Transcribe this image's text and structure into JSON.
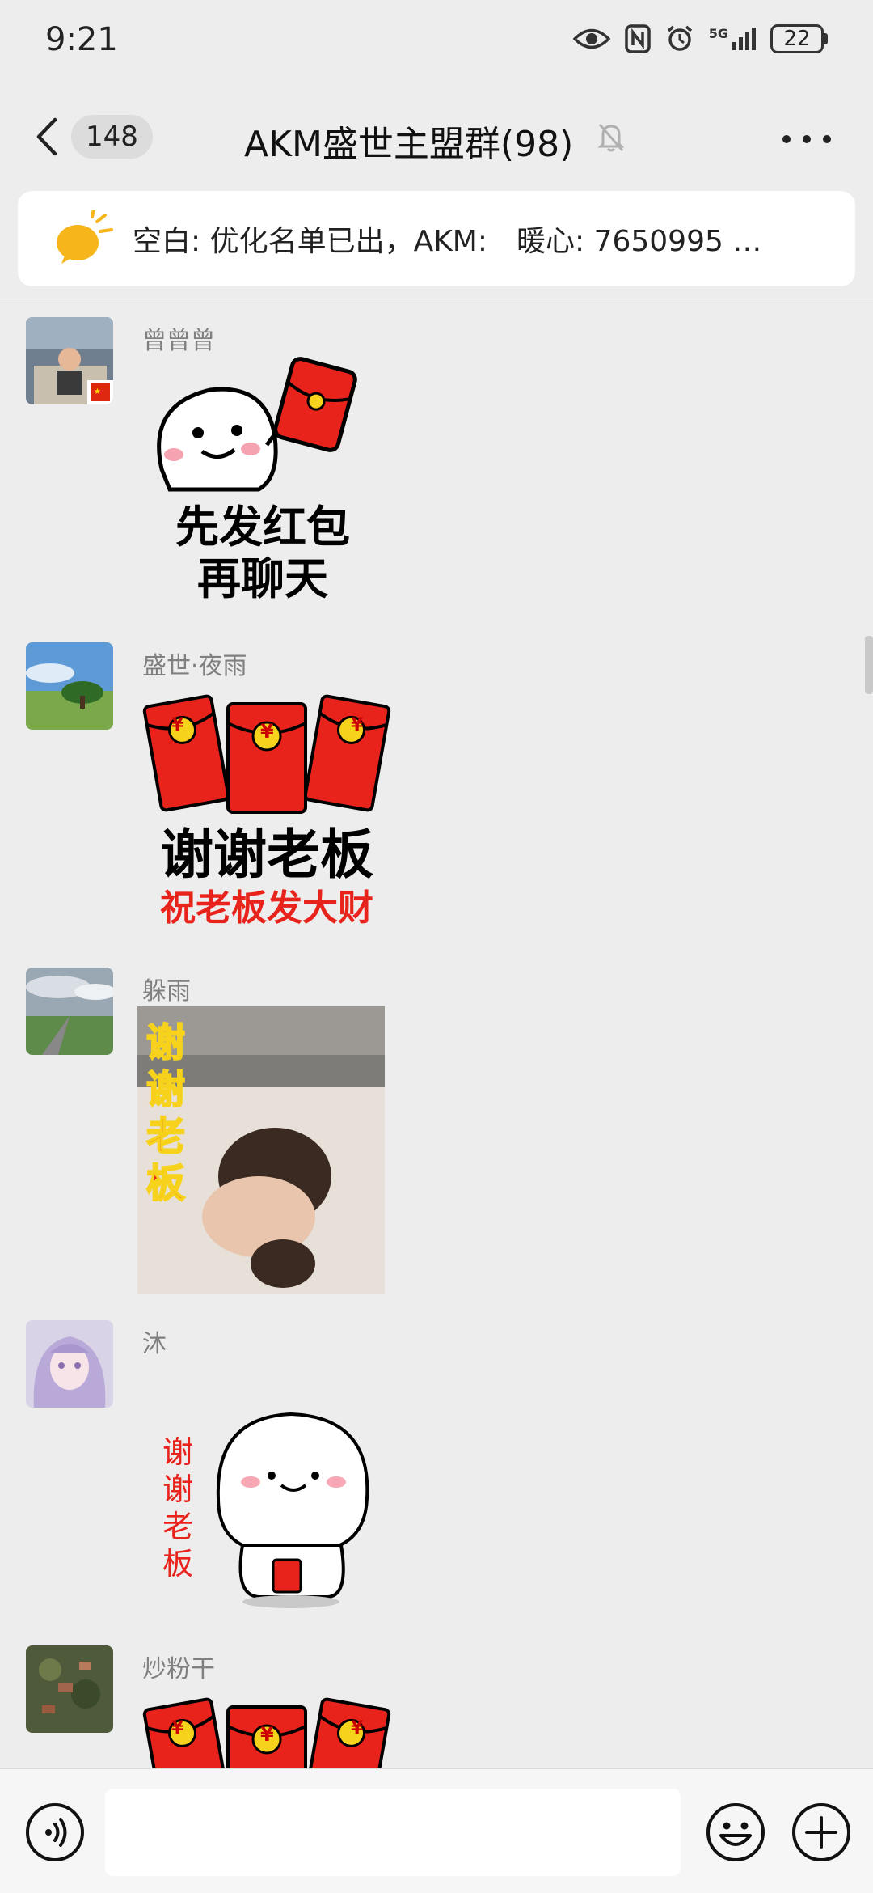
{
  "status_bar": {
    "time": "9:21",
    "network": "5G",
    "battery": "22"
  },
  "title_bar": {
    "unread_count": "148",
    "title": "AKM盛世主盟群(98)"
  },
  "notice": {
    "text": "空白: 优化名单已出，AKM:　暖心: 7650995 …"
  },
  "messages": [
    {
      "sender": "曾曾曾",
      "avatar_icon": "child-photo-avatar",
      "sticker_icon": "smiley-holding-red-envelope-sticker",
      "sticker_lines": [
        "先发红包",
        "再聊天"
      ]
    },
    {
      "sender": "盛世·夜雨",
      "avatar_icon": "landscape-tree-avatar",
      "sticker_icon": "red-envelopes-sticker",
      "envelope_marks": [
        "¥",
        "¥",
        "¥"
      ],
      "sticker_lines": [
        "谢谢老板",
        "祝老板发大财"
      ]
    },
    {
      "sender": "躲雨",
      "avatar_icon": "rainy-road-avatar",
      "sticker_icon": "kid-bowing-gif-sticker",
      "sticker_lines": [
        "谢",
        "谢",
        "老",
        "板"
      ]
    },
    {
      "sender": "沐",
      "avatar_icon": "anime-girl-avatar",
      "sticker_icon": "round-face-thanks-sticker",
      "sticker_lines": [
        "谢",
        "谢",
        "老",
        "板"
      ]
    },
    {
      "sender": "炒粉干",
      "avatar_icon": "aerial-village-avatar",
      "sticker_icon": "red-envelopes-sticker",
      "envelope_marks": [
        "¥",
        "¥",
        "¥"
      ]
    }
  ],
  "input_bar": {
    "placeholder": ""
  },
  "colors": {
    "background": "#ededed",
    "red_envelope": "#e8231c",
    "envelope_gold": "#f7d21d",
    "sender_gray": "#808080"
  }
}
